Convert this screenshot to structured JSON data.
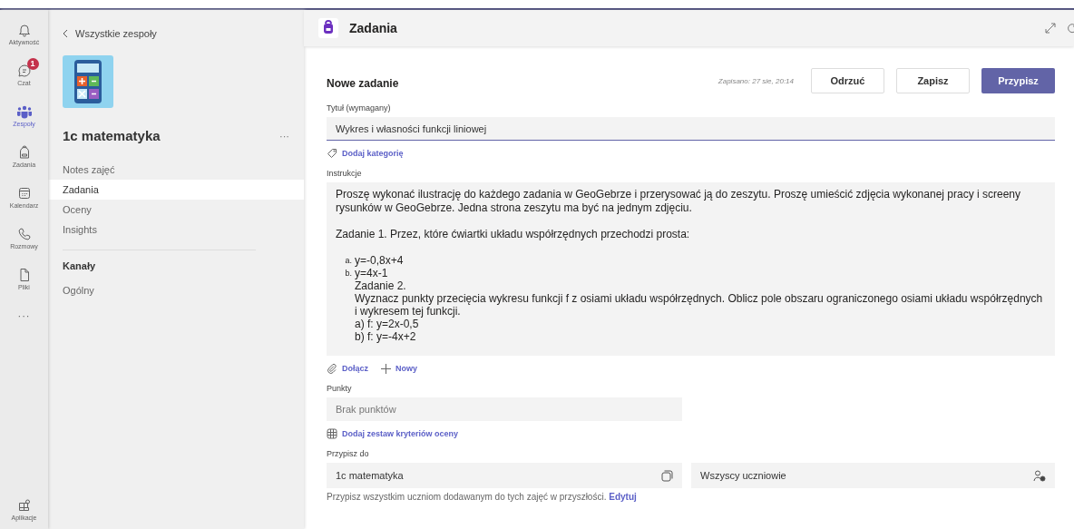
{
  "rail": {
    "items": [
      {
        "kind": "bell",
        "label": "Aktywność",
        "selected": false
      },
      {
        "kind": "chat",
        "label": "Czat",
        "selected": false,
        "badge": "1"
      },
      {
        "kind": "teams",
        "label": "Zespoły",
        "selected": true
      },
      {
        "kind": "bag",
        "label": "Zadania",
        "selected": false
      },
      {
        "kind": "calendar",
        "label": "Kalendarz",
        "selected": false
      },
      {
        "kind": "phone",
        "label": "Rozmowy",
        "selected": false
      },
      {
        "kind": "file",
        "label": "Pliki",
        "selected": false
      }
    ],
    "more": "···",
    "apps": {
      "label": "Aplikacje"
    }
  },
  "team_panel": {
    "back": "Wszystkie zespoły",
    "name": "1c matematyka",
    "more": "···",
    "items": [
      {
        "label": "Notes zajęć",
        "selected": false
      },
      {
        "label": "Zadania",
        "selected": true
      },
      {
        "label": "Oceny",
        "selected": false
      },
      {
        "label": "Insights",
        "selected": false
      }
    ],
    "channels_heading": "Kanały",
    "channels": [
      {
        "label": "Ogólny",
        "selected": false
      }
    ]
  },
  "header": {
    "title": "Zadania"
  },
  "form": {
    "title": "Nowe zadanie",
    "saved": "Zapisano: 27 sie, 20:14",
    "buttons": [
      {
        "label": "Odrzuć",
        "kind": "secondary"
      },
      {
        "label": "Zapisz",
        "kind": "secondary"
      },
      {
        "label": "Przypisz",
        "kind": "primary"
      }
    ],
    "title_label": "Tytuł (wymagany)",
    "title_value": "Wykres i własności funkcji liniowej",
    "add_category": "Dodaj kategorię",
    "instructions_label": "Instrukcje",
    "instructions": [
      {
        "kind": "para",
        "text": "Proszę wykonać ilustrację do każdego zadania w GeoGebrze i przerysować ją do zeszytu. Proszę umieścić zdjęcia wykonanej pracy i screeny rysunków w GeoGebrze. Jedna strona zeszytu ma być na jednym zdjęciu."
      },
      {
        "kind": "para",
        "text": "Zadanie 1. Przez, które ćwiartki układu współrzędnych przechodzi prosta:"
      },
      {
        "kind": "item",
        "marker": "a.",
        "text": "y=-0,8x+4"
      },
      {
        "kind": "item",
        "marker": "b.",
        "text": "y=4x-1"
      },
      {
        "kind": "indent",
        "text": "Zadanie 2."
      },
      {
        "kind": "indent",
        "text": "Wyznacz punkty przecięcia wykresu funkcji f z osiami układu współrzędnych. Oblicz pole obszaru ograniczonego osiami układu współrzędnych i wykresem tej funkcji."
      },
      {
        "kind": "indent",
        "text": "a) f: y=2x-0,5"
      },
      {
        "kind": "indent",
        "text": "b) f: y=-4x+2"
      }
    ],
    "attach": "Dołącz",
    "new": "Nowy",
    "points_label": "Punkty",
    "points_placeholder": "Brak punktów",
    "rubric": "Dodaj zestaw kryteriów oceny",
    "assign_label": "Przypisz do",
    "assign_class": "1c matematyka",
    "assign_students": "Wszyscy uczniowie",
    "note": "Przypisz wszystkim uczniom dodawanym do tych zajęć w przyszłości.",
    "note_link": "Edytuj"
  }
}
